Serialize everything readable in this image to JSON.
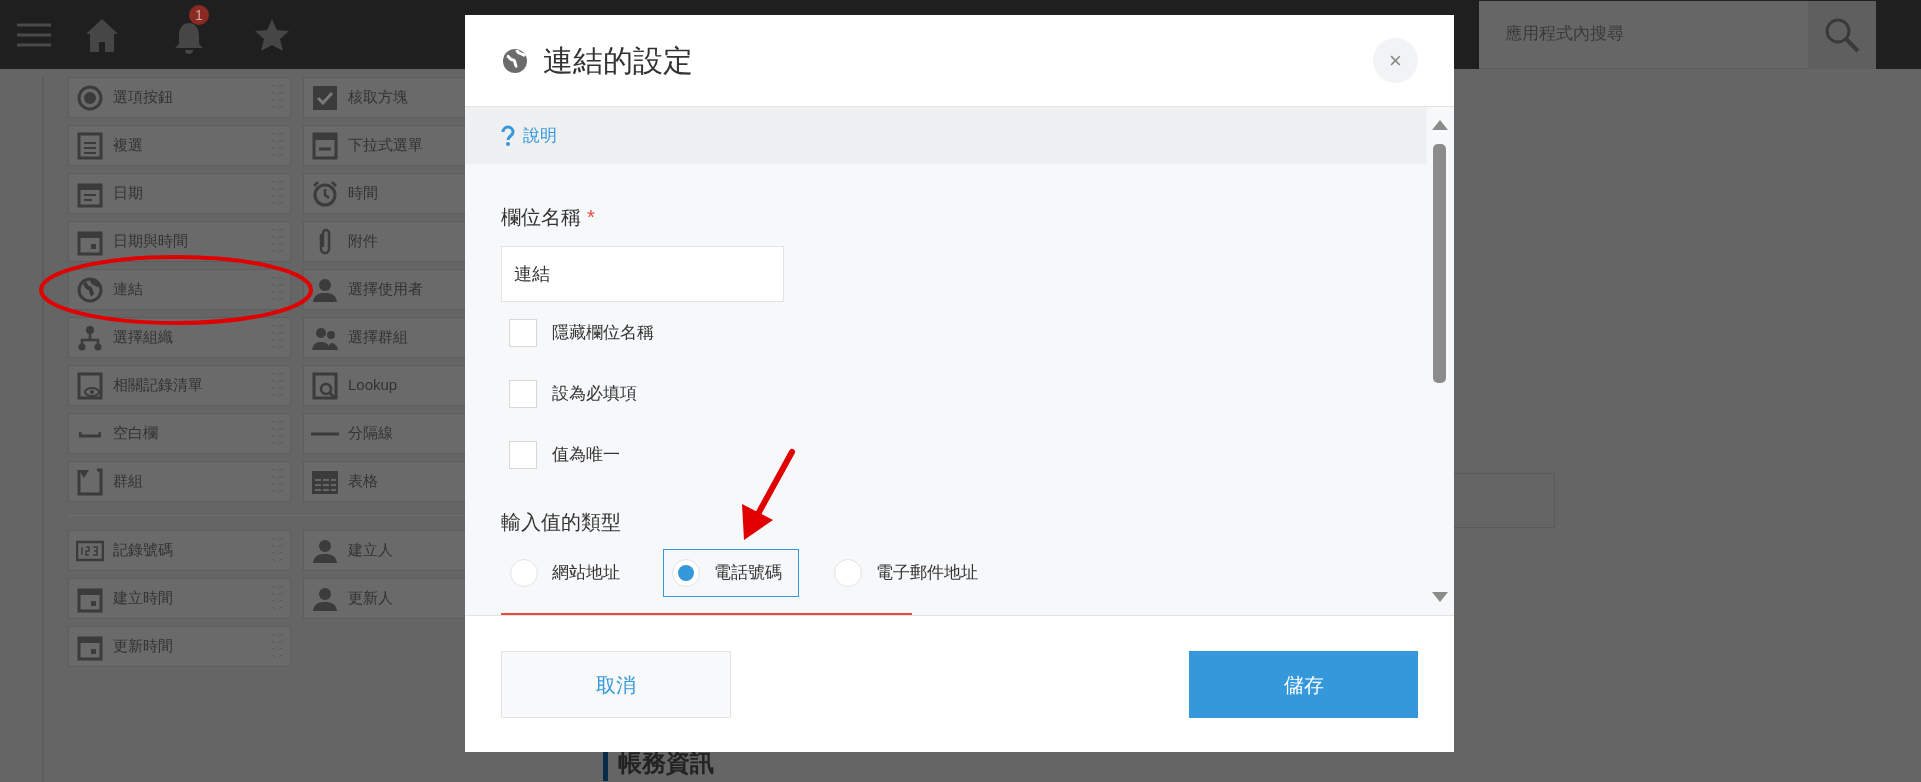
{
  "top_bar": {
    "notification_count": "1",
    "search": {
      "placeholder": "應用程式內搜尋"
    }
  },
  "field_palette": {
    "groups": [
      {
        "items": [
          {
            "label": "選項按鈕",
            "kind": "radio"
          },
          {
            "label": "核取方塊",
            "kind": "checkbox"
          },
          {
            "label": "複選",
            "kind": "list"
          },
          {
            "label": "下拉式選單",
            "kind": "dropdown"
          },
          {
            "label": "日期",
            "kind": "calendar"
          },
          {
            "label": "時間",
            "kind": "clock"
          },
          {
            "label": "日期與時間",
            "kind": "datetime"
          },
          {
            "label": "附件",
            "kind": "clip"
          },
          {
            "label": "連結",
            "kind": "globe"
          },
          {
            "label": "選擇使用者",
            "kind": "user"
          },
          {
            "label": "選擇組織",
            "kind": "org"
          },
          {
            "label": "選擇群組",
            "kind": "group"
          },
          {
            "label": "相關記錄清單",
            "kind": "related"
          },
          {
            "label": "Lookup",
            "kind": "lookup"
          },
          {
            "label": "空白欄",
            "kind": "space"
          },
          {
            "label": "分隔線",
            "kind": "line"
          },
          {
            "label": "群組",
            "kind": "groupbox"
          },
          {
            "label": "表格",
            "kind": "table"
          }
        ]
      },
      {
        "items": [
          {
            "label": "記錄號碼",
            "kind": "number"
          },
          {
            "label": "建立人",
            "kind": "user"
          },
          {
            "label": "建立時間",
            "kind": "datetime"
          },
          {
            "label": "更新人",
            "kind": "user"
          },
          {
            "label": "更新時間",
            "kind": "datetime"
          }
        ]
      }
    ]
  },
  "background_heading": "帳務資訊",
  "dialog": {
    "title": "連結的設定",
    "close_label": "×",
    "help_link": "說明",
    "field_name": {
      "label": "欄位名稱",
      "required_mark": "*",
      "value": "連結"
    },
    "options": [
      {
        "label": "隱藏欄位名稱",
        "checked": false
      },
      {
        "label": "設為必填項",
        "checked": false
      },
      {
        "label": "值為唯一",
        "checked": false
      }
    ],
    "input_type": {
      "label": "輸入值的類型",
      "choices": [
        {
          "label": "網站地址",
          "selected": false
        },
        {
          "label": "電話號碼",
          "selected": true
        },
        {
          "label": "電子郵件地址",
          "selected": false
        }
      ]
    },
    "buttons": {
      "cancel": "取消",
      "save": "儲存"
    }
  }
}
